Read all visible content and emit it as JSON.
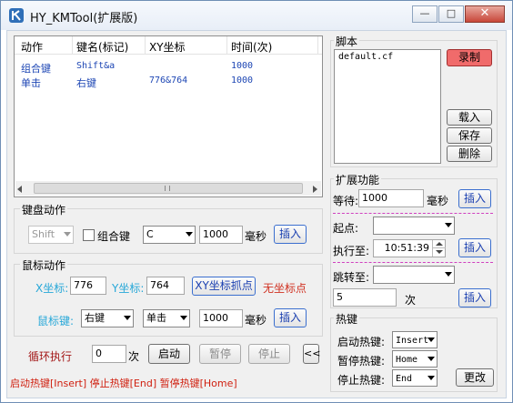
{
  "window": {
    "title": "HY_KMTool(扩展版)",
    "buttons": {
      "minimize": "—",
      "maximize": "□",
      "close": "✕"
    }
  },
  "list": {
    "columns": [
      "动作",
      "键名(标记)",
      "XY坐标",
      "时间(次)"
    ],
    "rows": [
      [
        "组合键",
        "Shift&a",
        "",
        "1000"
      ],
      [
        "单击",
        "右键",
        "776&764",
        "1000"
      ]
    ]
  },
  "keyboard": {
    "group_label": "键盘动作",
    "key_select": "Shift",
    "combo_check_label": "组合键",
    "combo_key": "C",
    "delay_value": "1000",
    "unit": "毫秒",
    "insert_label": "插入"
  },
  "mouse": {
    "group_label": "鼠标动作",
    "x_label": "X坐标:",
    "x_value": "776",
    "y_label": "Y坐标:",
    "y_value": "764",
    "capture_label": "XY坐标抓点",
    "no_coord_label": "无坐标点",
    "key_label": "鼠标键:",
    "button_select": "右键",
    "action_select": "单击",
    "delay_value": "1000",
    "unit": "毫秒",
    "insert_label": "插入"
  },
  "loop": {
    "label": "循环执行",
    "count": "0",
    "unit": "次",
    "start": "启动",
    "pause": "暂停",
    "stop": "停止",
    "collapse": "<<"
  },
  "status_text": "启动热键[Insert] 停止热键[End] 暂停热键[Home]",
  "script": {
    "group_label": "脚本",
    "file": "default.cf",
    "record": "录制",
    "load": "载入",
    "save": "保存",
    "delete": "删除"
  },
  "extended": {
    "group_label": "扩展功能",
    "wait_label": "等待:",
    "wait_value": "1000",
    "wait_unit": "毫秒",
    "insert_label": "插入",
    "start_label": "起点:",
    "exec_label": "执行至:",
    "exec_time": "10:51:39",
    "jump_label": "跳转至:",
    "jump_count": "5",
    "jump_unit": "次"
  },
  "hotkeys": {
    "group_label": "热键",
    "start_label": "启动热键:",
    "start_key": "Insert",
    "pause_label": "暂停热键:",
    "pause_key": "Home",
    "stop_label": "停止热键:",
    "stop_key": "End",
    "change": "更改"
  },
  "colors": {
    "accent_blue": "#1d46b4",
    "record_red": "#f06b6b",
    "status_red": "#d02010",
    "coord_cyan": "#28a8d8",
    "separator_magenta": "#d040c0"
  }
}
